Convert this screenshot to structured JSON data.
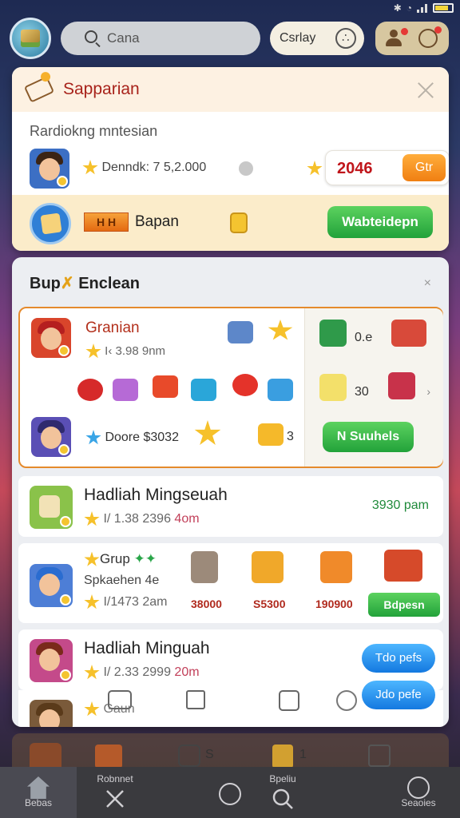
{
  "status_bar": {
    "icons": [
      "bluetooth-icon",
      "wifi-icon",
      "signal-icon",
      "battery-icon"
    ]
  },
  "topbar": {
    "search_placeholder": "Cana",
    "play_label": "Csrlay"
  },
  "card1": {
    "title": "Sapparian",
    "subtitle": "Rardiokng mntesian",
    "row": {
      "meta": "Denndk: 7 5,2.000",
      "score": "2046",
      "button": "Gtr"
    },
    "footer": {
      "badge": "H  H",
      "label": "Bapan",
      "button": "Wabteidepn"
    }
  },
  "card2": {
    "title": "Bup",
    "title_tail": "Enclean",
    "close": "×",
    "featured": {
      "name": "Granian",
      "meta": "I‹ 3.98 9nm",
      "meta2": "Doore $3032",
      "right_values": [
        "0.e",
        "30"
      ],
      "count": "3",
      "button": "N Suuhels"
    },
    "rows": [
      {
        "title": "Hadliah Mingseuah",
        "meta_main": "I/ 1.38 2396 ",
        "meta_tail": "4om",
        "right": "3930 pam"
      },
      {
        "group_label": "Grup",
        "sub": "Spkaehen 4e",
        "meta_main": "I/1473 2am",
        "gift_values": [
          "38000",
          "S5300",
          "190900"
        ],
        "button": "Bdpesn"
      },
      {
        "title": "Hadliah Minguah",
        "meta_main": "I/ 2.33 2999 ",
        "meta_tail": "20m",
        "button": "Tdo pefs"
      },
      {
        "meta_main": "Gaun",
        "button": "Jdo pefe"
      }
    ]
  },
  "bottom_strip": {
    "labels": [
      "S",
      "1"
    ]
  },
  "navbar": {
    "items": [
      {
        "label": "Bebas",
        "icon": "home-icon"
      },
      {
        "label": "Robnnet",
        "icon": "cross-icon"
      },
      {
        "label": "",
        "icon": "circle-icon"
      },
      {
        "label": "Bpeliu",
        "icon": "search-icon"
      },
      {
        "label": "Seaoies",
        "icon": "apple-icon"
      }
    ]
  },
  "colors": {
    "accent_red": "#c0161b",
    "accent_green": "#22a23a",
    "accent_blue": "#1479e0",
    "accent_orange": "#f07f12"
  }
}
